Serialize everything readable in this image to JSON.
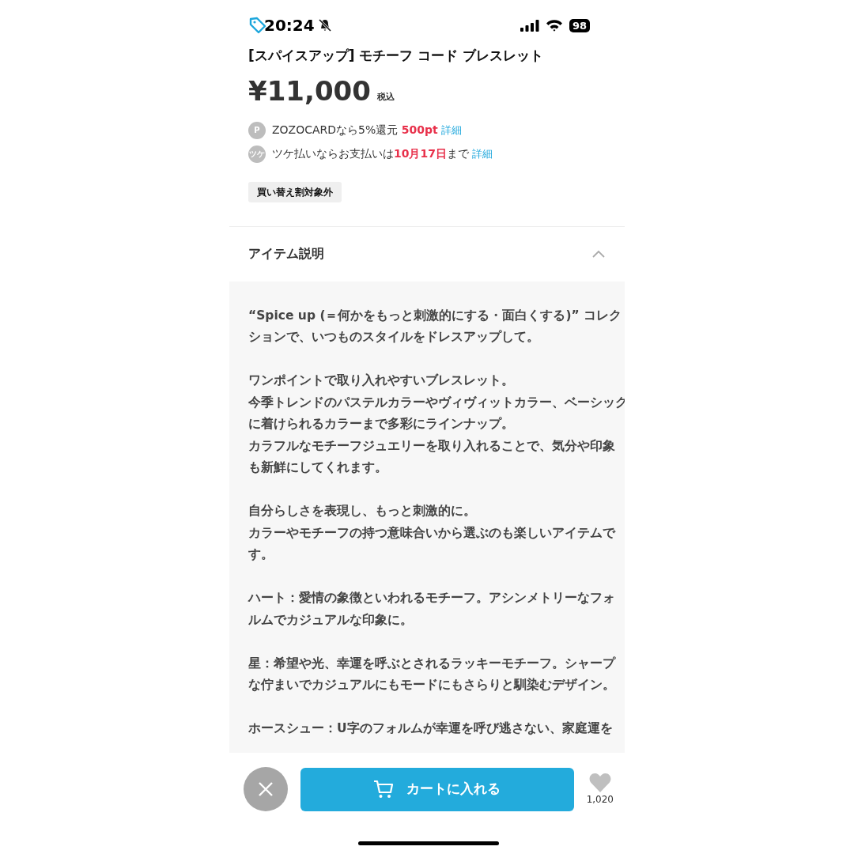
{
  "status_bar": {
    "time": "20:24",
    "battery": "98"
  },
  "product": {
    "title": "[スパイスアップ] モチーフ コード ブレスレット",
    "price": "¥11,000",
    "tax_note": "税込"
  },
  "benefits": [
    {
      "badge": "P",
      "text": "ZOZOCARDなら5%還元 ",
      "highlight": "500pt",
      "link": "詳細"
    },
    {
      "badge": "ツケ",
      "text": "ツケ払いならお支払いは",
      "highlight": "10月17日",
      "text_after": "まで",
      "link": "詳細"
    }
  ],
  "tag": "買い替え割対象外",
  "section": {
    "title": "アイテム説明",
    "expanded": true,
    "paragraphs": [
      [
        "“Spice up (＝何かをもっと刺激的にする・面白くする)” コレク",
        "ションで、いつものスタイルをドレスアップして。"
      ],
      [
        "ワンポイントで取り入れやすいブレスレット。",
        "今季トレンドのパステルカラーやヴィヴィットカラー、ベーシック",
        "に着けられるカラーまで多彩にラインナップ。",
        "カラフルなモチーフジュエリーを取り入れることで、気分や印象",
        "も新鮮にしてくれます。"
      ],
      [
        "自分らしさを表現し、もっと刺激的に。",
        "カラーやモチーフの持つ意味合いから選ぶのも楽しいアイテムで",
        "す。"
      ],
      [
        "ハート：愛情の象徴といわれるモチーフ。アシンメトリーなフォ",
        "ルムでカジュアルな印象に。"
      ],
      [
        "星：希望や光、幸運を呼ぶとされるラッキーモチーフ。シャープ",
        "な佇まいでカジュアルにもモードにもさらりと馴染むデザイン。"
      ],
      [
        "ホースシュー：U字のフォルムが幸運を呼び逃さない、家庭運を"
      ]
    ]
  },
  "cart_button": "カートに入れる",
  "like_count": "1,020"
}
